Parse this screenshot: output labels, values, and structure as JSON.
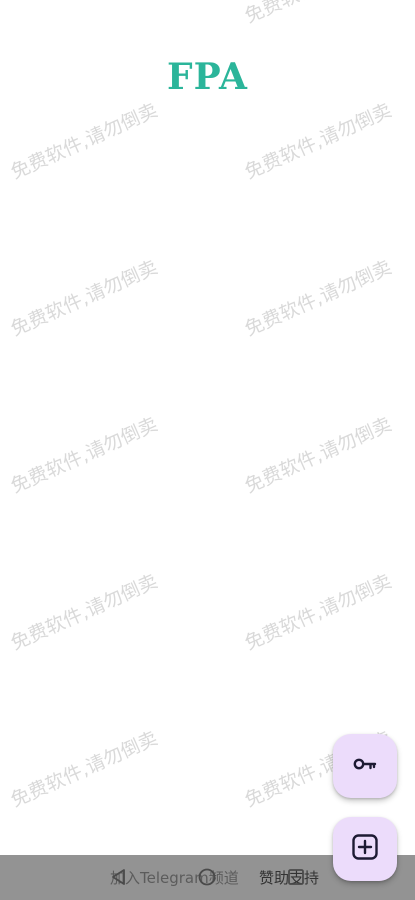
{
  "app": {
    "title": "FPA",
    "title_color": "#2bb59a"
  },
  "watermark": {
    "text": "免费软件,请勿倒卖"
  },
  "fabs": {
    "key_icon": "key-icon",
    "add_icon": "add-box-icon",
    "background": "#ecdcfb"
  },
  "bottom_bar": {
    "telegram_link": "加入Telegram频道",
    "donate_link": "赞助支持"
  },
  "system_nav": {
    "back_icon": "back-triangle-icon",
    "home_icon": "home-circle-icon",
    "recent_icon": "recent-square-icon"
  }
}
